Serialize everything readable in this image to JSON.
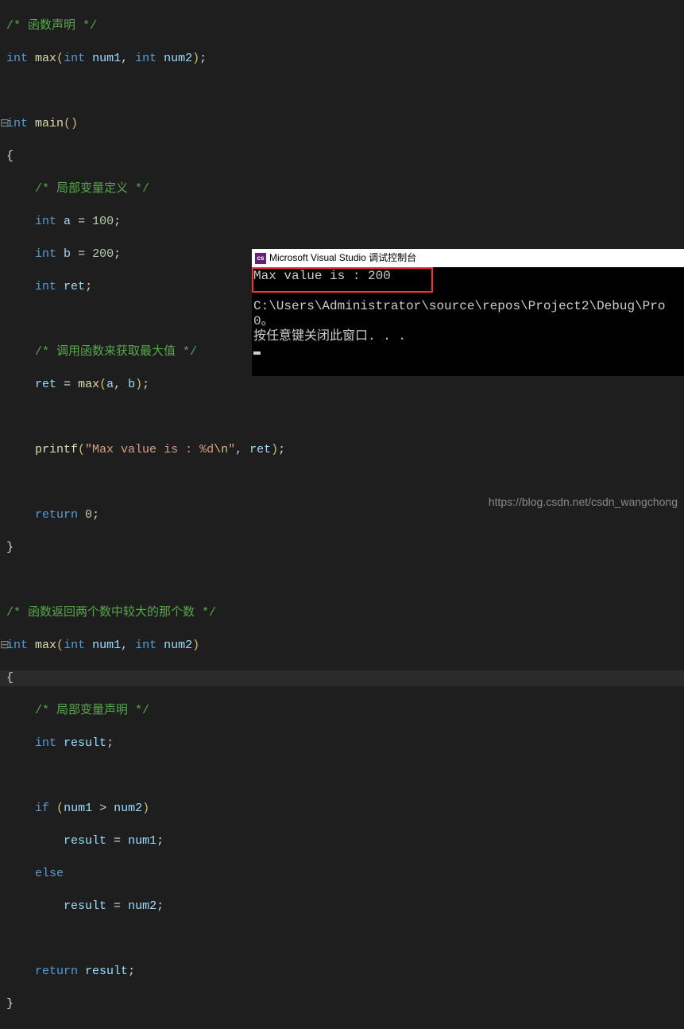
{
  "code": {
    "l1": "/* 函数声明 */",
    "l2_type": "int",
    "l2_func": "max",
    "l2_p1t": "int",
    "l2_p1": " num1",
    "l2_p2t": "int",
    "l2_p2": " num2",
    "l4_type": "int",
    "l4_func": "main",
    "l6_c": "/* 局部变量定义 */",
    "l7_t": "int",
    "l7_v": "a",
    "l7_n": "100",
    "l8_t": "int",
    "l8_v": "b",
    "l8_n": "200",
    "l9_t": "int",
    "l9_v": "ret",
    "l11_c": "/* 调用函数来获取最大值 */",
    "l12_v1": "ret",
    "l12_f": "max",
    "l12_a1": "a",
    "l12_a2": "b",
    "l14_f": "printf",
    "l14_s": "\"Max value is : %d",
    "l14_esc": "\\n",
    "l14_s2": "\"",
    "l14_v": "ret",
    "l16_k": "return",
    "l16_n": "0",
    "l19_c": "/* 函数返回两个数中较大的那个数 */",
    "l20_t": "int",
    "l20_f": "max",
    "l20_p1t": "int",
    "l20_p1": " num1",
    "l20_p2t": "int",
    "l20_p2": " num2",
    "l22_c": "/* 局部变量声明 */",
    "l23_t": "int",
    "l23_v": "result",
    "l25_k": "if",
    "l25_a": "num1",
    "l25_op": ">",
    "l25_b": "num2",
    "l26_v": "result",
    "l26_r": "num1",
    "l27_k": "else",
    "l28_v": "result",
    "l28_r": "num2",
    "l30_k": "return",
    "l30_v": "result"
  },
  "console": {
    "title": "Microsoft Visual Studio 调试控制台",
    "line1": "Max value is : 200",
    "line2": "C:\\Users\\Administrator\\source\\repos\\Project2\\Debug\\Pro",
    "line3": "0。",
    "line4": "按任意键关闭此窗口. . ."
  },
  "watermark": "https://blog.csdn.net/csdn_wangchong"
}
